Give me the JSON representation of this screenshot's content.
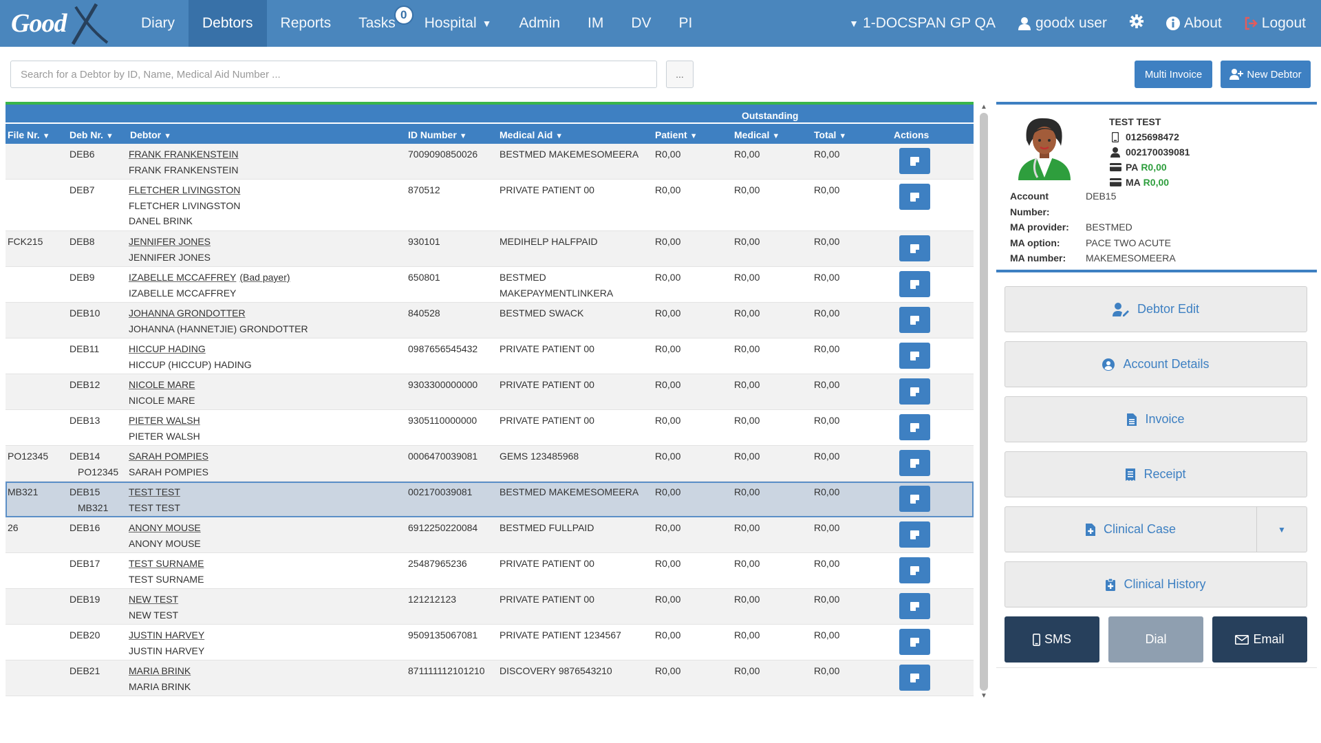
{
  "brand": {
    "logo_text": "Good"
  },
  "nav": {
    "left": [
      {
        "label": "Diary",
        "active": false
      },
      {
        "label": "Debtors",
        "active": true
      },
      {
        "label": "Reports",
        "active": false
      },
      {
        "label": "Tasks",
        "active": false
      },
      {
        "label": "Hospital",
        "active": false
      },
      {
        "label": "Admin",
        "active": false
      },
      {
        "label": "IM",
        "active": false
      },
      {
        "label": "DV",
        "active": false
      },
      {
        "label": "PI",
        "active": false
      }
    ],
    "tasks_badge": "0",
    "practice": "1-DOCSPAN GP QA",
    "user": "goodx user",
    "about": "About",
    "logout": "Logout"
  },
  "search": {
    "placeholder": "Search for a Debtor by ID, Name, Medical Aid Number ...",
    "value": "",
    "more_label": "...",
    "multi_invoice": "Multi Invoice",
    "new_debtor": "New Debtor"
  },
  "table": {
    "group_header": "Outstanding",
    "columns": [
      "File Nr.",
      "Deb Nr.",
      "Debtor",
      "ID Number",
      "Medical Aid",
      "Patient",
      "Medical",
      "Total",
      "Actions"
    ],
    "rows": [
      {
        "file": "",
        "deb": "DEB6",
        "deb2": "",
        "names": [
          "FRANK FRANKENSTEIN",
          "FRANK FRANKENSTEIN"
        ],
        "note": "",
        "id": "7009090850026",
        "aid": [
          "BESTMED MAKEMESOMEERA"
        ],
        "patient": "R0,00",
        "medical": "R0,00",
        "total": "R0,00"
      },
      {
        "file": "",
        "deb": "DEB7",
        "deb2": "",
        "names": [
          "FLETCHER LIVINGSTON",
          "FLETCHER LIVINGSTON",
          "DANEL BRINK"
        ],
        "note": "",
        "id": "870512",
        "aid": [
          "PRIVATE PATIENT 00"
        ],
        "patient": "R0,00",
        "medical": "R0,00",
        "total": "R0,00"
      },
      {
        "file": "FCK215",
        "deb": "DEB8",
        "deb2": "",
        "names": [
          "JENNIFER JONES",
          "JENNIFER JONES"
        ],
        "note": "",
        "id": "930101",
        "aid": [
          "MEDIHELP HALFPAID"
        ],
        "patient": "R0,00",
        "medical": "R0,00",
        "total": "R0,00"
      },
      {
        "file": "",
        "deb": "DEB9",
        "deb2": "",
        "names": [
          "IZABELLE MCCAFFREY",
          "IZABELLE MCCAFFREY"
        ],
        "note": "(Bad payer)",
        "id": "650801",
        "aid": [
          "BESTMED",
          "MAKEPAYMENTLINKERA"
        ],
        "patient": "R0,00",
        "medical": "R0,00",
        "total": "R0,00"
      },
      {
        "file": "",
        "deb": "DEB10",
        "deb2": "",
        "names": [
          "JOHANNA GRONDOTTER",
          "JOHANNA (HANNETJIE) GRONDOTTER"
        ],
        "note": "",
        "id": "840528",
        "aid": [
          "BESTMED SWACK"
        ],
        "patient": "R0,00",
        "medical": "R0,00",
        "total": "R0,00"
      },
      {
        "file": "",
        "deb": "DEB11",
        "deb2": "",
        "names": [
          "HICCUP HADING",
          "HICCUP (HICCUP) HADING"
        ],
        "note": "",
        "id": "0987656545432",
        "aid": [
          "PRIVATE PATIENT 00"
        ],
        "patient": "R0,00",
        "medical": "R0,00",
        "total": "R0,00"
      },
      {
        "file": "",
        "deb": "DEB12",
        "deb2": "",
        "names": [
          "NICOLE MARE",
          "NICOLE MARE"
        ],
        "note": "",
        "id": "9303300000000",
        "aid": [
          "PRIVATE PATIENT 00"
        ],
        "patient": "R0,00",
        "medical": "R0,00",
        "total": "R0,00"
      },
      {
        "file": "",
        "deb": "DEB13",
        "deb2": "",
        "names": [
          "PIETER WALSH",
          "PIETER WALSH"
        ],
        "note": "",
        "id": "9305110000000",
        "aid": [
          "PRIVATE PATIENT 00"
        ],
        "patient": "R0,00",
        "medical": "R0,00",
        "total": "R0,00"
      },
      {
        "file": "PO12345",
        "deb": "DEB14",
        "deb2": "PO12345",
        "names": [
          "SARAH POMPIES",
          "SARAH POMPIES"
        ],
        "note": "",
        "id": "0006470039081",
        "aid": [
          "GEMS 123485968"
        ],
        "patient": "R0,00",
        "medical": "R0,00",
        "total": "R0,00"
      },
      {
        "file": "MB321",
        "deb": "DEB15",
        "deb2": "MB321",
        "names": [
          "TEST TEST",
          "TEST TEST"
        ],
        "note": "",
        "id": "002170039081",
        "aid": [
          "BESTMED MAKEMESOMEERA"
        ],
        "patient": "R0,00",
        "medical": "R0,00",
        "total": "R0,00",
        "selected": true
      },
      {
        "file": "26",
        "deb": "DEB16",
        "deb2": "",
        "names": [
          "ANONY MOUSE",
          "ANONY MOUSE"
        ],
        "note": "",
        "id": "6912250220084",
        "aid": [
          "BESTMED FULLPAID"
        ],
        "patient": "R0,00",
        "medical": "R0,00",
        "total": "R0,00"
      },
      {
        "file": "",
        "deb": "DEB17",
        "deb2": "",
        "names": [
          "TEST SURNAME",
          "TEST SURNAME"
        ],
        "note": "",
        "id": "25487965236",
        "aid": [
          "PRIVATE PATIENT 00"
        ],
        "patient": "R0,00",
        "medical": "R0,00",
        "total": "R0,00"
      },
      {
        "file": "",
        "deb": "DEB19",
        "deb2": "",
        "names": [
          "NEW TEST",
          "NEW TEST"
        ],
        "note": "",
        "id": "121212123",
        "aid": [
          "PRIVATE PATIENT 00"
        ],
        "patient": "R0,00",
        "medical": "R0,00",
        "total": "R0,00"
      },
      {
        "file": "",
        "deb": "DEB20",
        "deb2": "",
        "names": [
          "JUSTIN HARVEY",
          "JUSTIN HARVEY"
        ],
        "note": "",
        "id": "9509135067081",
        "aid": [
          "PRIVATE PATIENT 1234567"
        ],
        "patient": "R0,00",
        "medical": "R0,00",
        "total": "R0,00"
      },
      {
        "file": "",
        "deb": "DEB21",
        "deb2": "",
        "names": [
          "MARIA BRINK",
          "MARIA BRINK"
        ],
        "note": "",
        "id": "871111112101210",
        "aid": [
          "DISCOVERY 9876543210"
        ],
        "patient": "R0,00",
        "medical": "R0,00",
        "total": "R0,00"
      }
    ]
  },
  "profile": {
    "name": "TEST TEST",
    "phone": "0125698472",
    "id_number": "002170039081",
    "pa_label": "PA",
    "pa_value": "R0,00",
    "ma_label": "MA",
    "ma_value": "R0,00",
    "details": [
      {
        "key": "Account",
        "value": "DEB15"
      },
      {
        "key": "Number:",
        "value": ""
      },
      {
        "key": "MA provider:",
        "value": "BESTMED"
      },
      {
        "key": "MA option:",
        "value": "PACE TWO ACUTE"
      },
      {
        "key": "MA number:",
        "value": "MAKEMESOMEERA"
      }
    ]
  },
  "actions": {
    "debtor_edit": "Debtor Edit",
    "account_details": "Account Details",
    "invoice": "Invoice",
    "receipt": "Receipt",
    "clinical_case": "Clinical Case",
    "clinical_history": "Clinical History",
    "sms": "SMS",
    "dial": "Dial",
    "email": "Email"
  },
  "colors": {
    "nav_bg": "#4a86bd",
    "primary": "#3e80c2",
    "green_accent": "#39b54a",
    "dark_button": "#27405c",
    "gray_button": "#8f9fb0"
  }
}
